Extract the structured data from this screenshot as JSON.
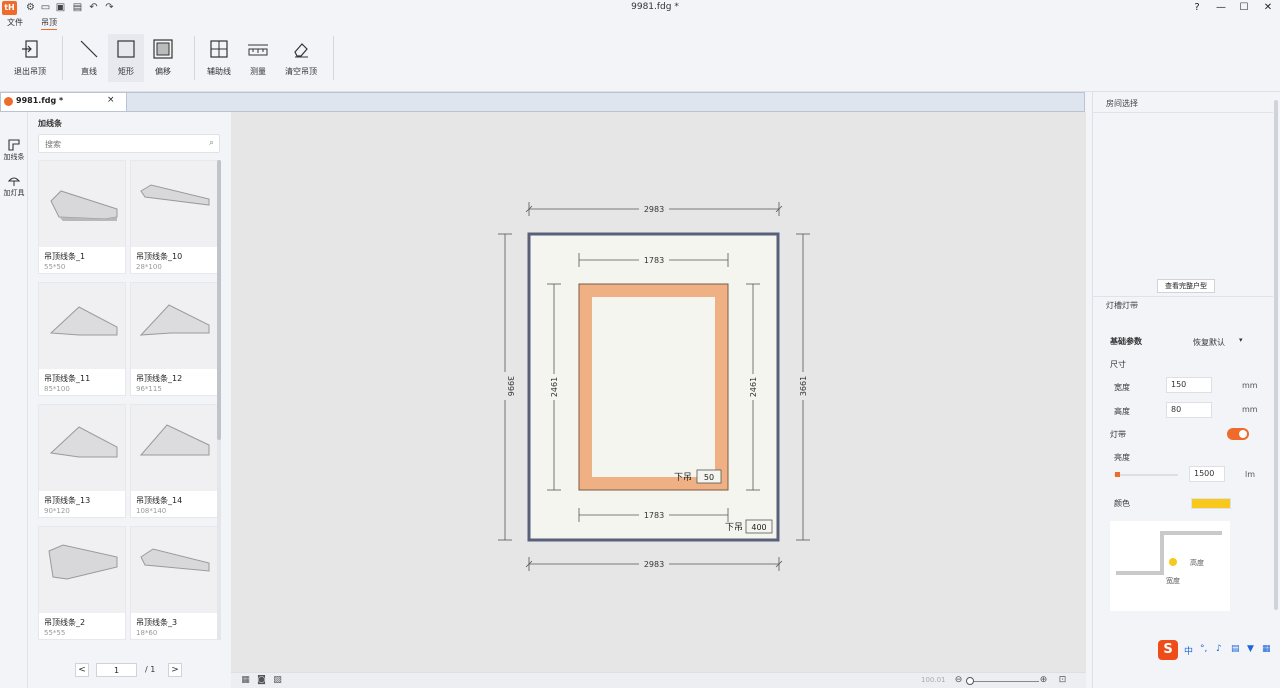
{
  "window": {
    "title": "9981.fdg *",
    "logo_text": "tH",
    "controls": {
      "help": "?",
      "minimize": "—",
      "maximize": "☐",
      "close": "✕"
    }
  },
  "menu": {
    "file": "文件",
    "ceiling": "吊顶"
  },
  "ribbon": {
    "exit": "退出吊顶",
    "line": "直线",
    "rect": "矩形",
    "offset": "偏移",
    "aux_line": "辅助线",
    "measure": "测量",
    "clear": "清空吊顶"
  },
  "doc_tab": {
    "name": "9981.fdg *",
    "close": "×"
  },
  "side_tabs": {
    "molding": "加线条",
    "lamp": "加灯具"
  },
  "library": {
    "title": "加线条",
    "search_placeholder": "搜索",
    "items": [
      {
        "name": "吊顶线条_1",
        "size": "55*50"
      },
      {
        "name": "吊顶线条_10",
        "size": "28*100"
      },
      {
        "name": "吊顶线条_11",
        "size": "85*100"
      },
      {
        "name": "吊顶线条_12",
        "size": "96*115"
      },
      {
        "name": "吊顶线条_13",
        "size": "90*120"
      },
      {
        "name": "吊顶线条_14",
        "size": "108*140"
      },
      {
        "name": "吊顶线条_2",
        "size": "55*55"
      },
      {
        "name": "吊顶线条_3",
        "size": "18*60"
      }
    ],
    "pager": {
      "prev": "<",
      "page": "1",
      "total": "/ 1",
      "next": ">"
    }
  },
  "drawing": {
    "dim_top": "2983",
    "dim_bottom": "2983",
    "dim_left": "3996",
    "dim_right": "3661",
    "inner_top": "1783",
    "inner_bottom": "1783",
    "inner_left": "2461",
    "inner_right": "2461",
    "inner_drop_label": "下吊",
    "inner_drop_value": "50",
    "outer_drop_label": "下吊",
    "outer_drop_value": "400"
  },
  "canvas_bar": {
    "zoom": "100.01"
  },
  "right_panel": {
    "room_select": "房间选择",
    "view_full": "查看完整户型",
    "slot_title": "灯槽灯带",
    "basic_params": "基础参数",
    "preset": "恢复默认",
    "size": "尺寸",
    "width_label": "宽度",
    "width_value": "150",
    "height_label": "高度",
    "height_value": "80",
    "unit_mm": "mm",
    "light_label": "灯带",
    "light_on": true,
    "brightness_label": "亮度",
    "brightness_value": "1500",
    "brightness_unit": "lm",
    "brightness_fraction": 0.05,
    "color_label": "颜色",
    "color_value": "#f8c91c",
    "diagram_height": "高度",
    "diagram_width": "宽度"
  },
  "ime": {
    "logo": "S",
    "lang": "中"
  }
}
